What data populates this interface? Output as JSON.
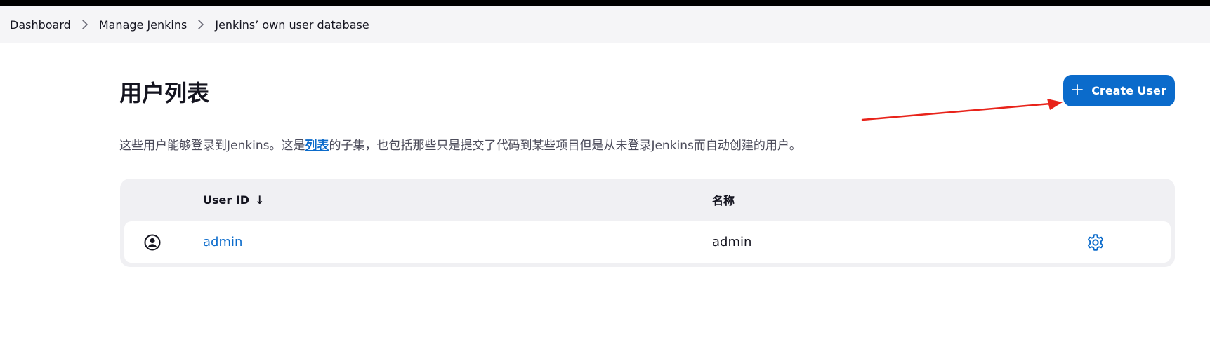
{
  "breadcrumb": {
    "items": [
      {
        "label": "Dashboard"
      },
      {
        "label": "Manage Jenkins"
      },
      {
        "label": "Jenkins’ own user database"
      }
    ]
  },
  "page": {
    "title": "用户列表",
    "create_button_label": "Create User",
    "description": {
      "before": "这些用户能够登录到Jenkins。这是",
      "link": "列表",
      "after": "的子集，也包括那些只是提交了代码到某些项目但是从未登录Jenkins而自动创建的用户。"
    }
  },
  "table": {
    "columns": {
      "user_id": "User ID",
      "sort_indicator": "↓",
      "name": "名称"
    },
    "rows": [
      {
        "user_id": "admin",
        "name": "admin"
      }
    ]
  },
  "icons": {
    "breadcrumb_separator": "chevron-right-icon",
    "create": "plus-icon",
    "avatar": "user-circle-icon",
    "settings": "gear-icon",
    "annotation": "red-arrow-annotation"
  },
  "colors": {
    "accent": "#0b6bcb",
    "annotation": "#e8231a",
    "breadcrumb_bg": "#f5f5f7",
    "table_bg": "#f0f0f3"
  }
}
